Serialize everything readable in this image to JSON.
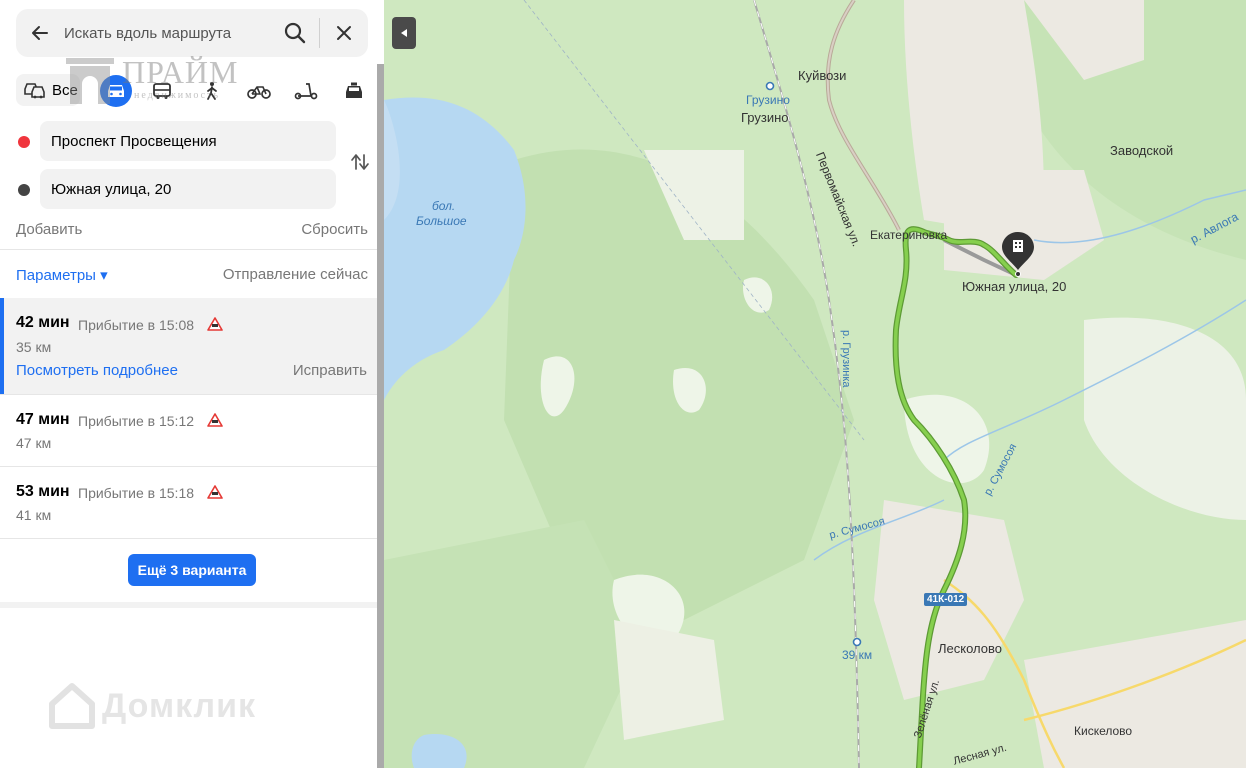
{
  "search": {
    "placeholder": "Искать вдоль маршрута"
  },
  "modes": {
    "all_label": "Все"
  },
  "route_points": {
    "from": "Проспект Просвещения",
    "to": "Южная улица, 20"
  },
  "actions": {
    "add": "Добавить",
    "reset": "Сбросить"
  },
  "params": {
    "label": "Параметры ▾",
    "departure": "Отправление сейчас"
  },
  "routes": [
    {
      "time": "42 мин",
      "arrival": "Прибытие в 15:08",
      "distance": "35 км",
      "details": "Посмотреть подробнее",
      "fix": "Исправить"
    },
    {
      "time": "47 мин",
      "arrival": "Прибытие в 15:12",
      "distance": "47 км"
    },
    {
      "time": "53 мин",
      "arrival": "Прибытие в 15:18",
      "distance": "41 км"
    }
  ],
  "more_button": "Ещё 3 варианта",
  "watermarks": {
    "praim_big": "ПРАЙМ",
    "praim_small": "недвижимость",
    "domclick": "Домклик"
  },
  "map": {
    "labels": {
      "kuivozi": "Куйвози",
      "gruzino_station": "Грузино",
      "gruzino": "Грузино",
      "zavodskoy": "Заводской",
      "bol": "бол.",
      "bolshoe": "Большое",
      "pervomaiskaya": "Первомайская ул.",
      "ekaterinovka": "Екатериновка",
      "destination": "Южная улица, 20",
      "avloga": "р. Авлога",
      "gruzinka": "р. Грузинка",
      "sumosoya1": "р. Сумосоя",
      "sumosoya2": "р. Сумосоя",
      "road_badge": "41К-012",
      "km39": "39 км",
      "leskolovo": "Лесколово",
      "zelenaya": "Зелёная ул.",
      "kiskelovo": "Кискелово",
      "lesnaya": "Лесная ул."
    }
  },
  "colors": {
    "accent": "#1e6ff1",
    "route_green": "#7cc245",
    "forest": "#cfe8c0",
    "water": "#b6d8f2"
  }
}
